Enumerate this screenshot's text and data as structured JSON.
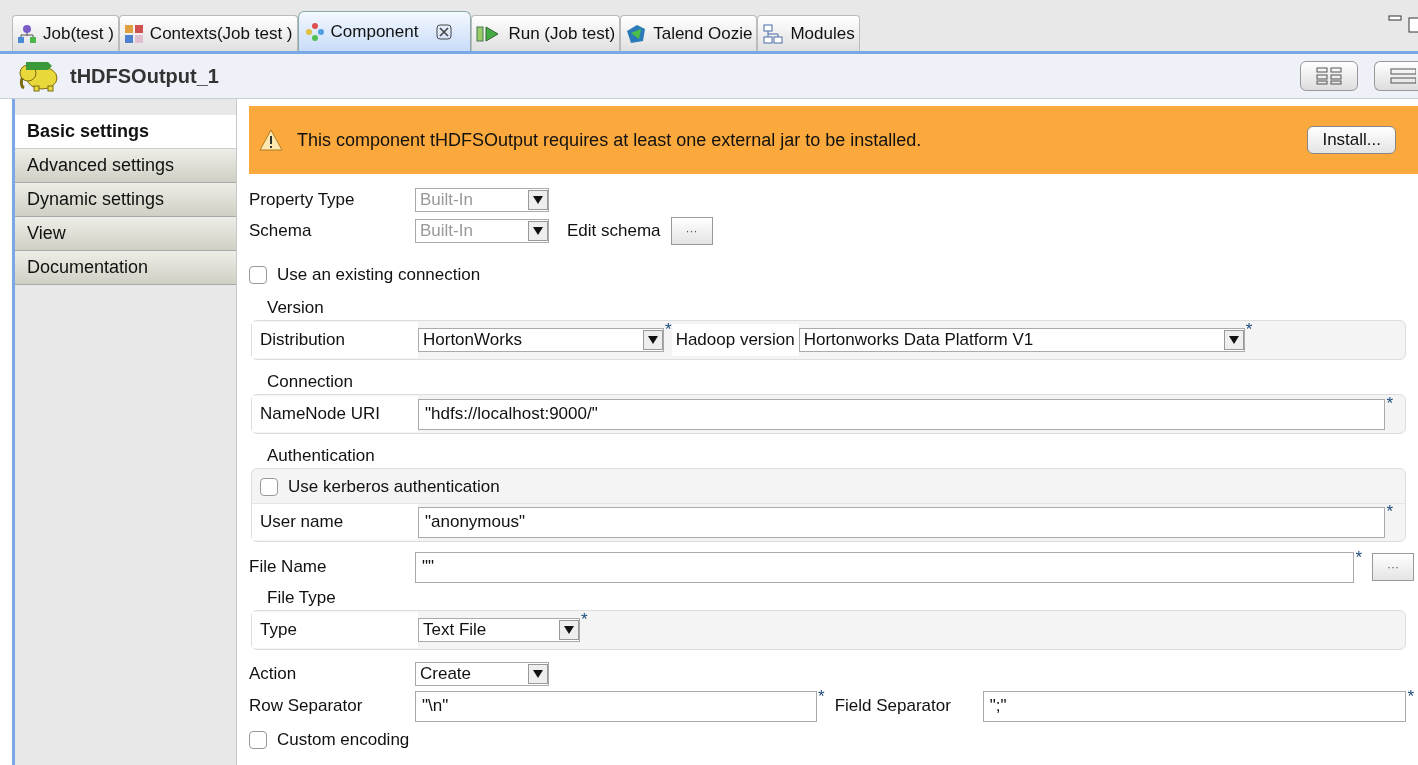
{
  "tabs": [
    {
      "label": "Job(test )",
      "selected": false,
      "kind": "job"
    },
    {
      "label": "Contexts(Job test )",
      "selected": false,
      "kind": "contexts"
    },
    {
      "label": "Component",
      "selected": true,
      "kind": "component",
      "closable": true
    },
    {
      "label": "Run (Job test)",
      "selected": false,
      "kind": "run"
    },
    {
      "label": "Talend Oozie",
      "selected": false,
      "kind": "oozie"
    },
    {
      "label": "Modules",
      "selected": false,
      "kind": "modules"
    }
  ],
  "component": {
    "title": "tHDFSOutput_1"
  },
  "nav": [
    {
      "label": "Basic settings",
      "selected": true
    },
    {
      "label": "Advanced settings",
      "selected": false
    },
    {
      "label": "Dynamic settings",
      "selected": false
    },
    {
      "label": "View",
      "selected": false
    },
    {
      "label": "Documentation",
      "selected": false
    }
  ],
  "warning": {
    "text": "This component tHDFSOutput requires at least one external jar to be installed.",
    "button": "Install..."
  },
  "form": [
    {
      "kind": "select",
      "label": "Property Type",
      "value": "Built-In",
      "disabled": true
    },
    {
      "kind": "select",
      "label": "Schema",
      "value": "Built-In",
      "disabled": true,
      "extra_label": "Edit schema",
      "button": "···"
    },
    {
      "kind": "checkbox",
      "label": "Use an existing connection",
      "checked": false
    },
    {
      "kind": "group",
      "title": "Version",
      "rows": [
        {
          "kind": "pair",
          "label": "Distribution",
          "value": "HortonWorks",
          "mark": "*",
          "label2": "Hadoop version",
          "value2": "Hortonworks Data Platform V1",
          "mark2": "*"
        }
      ]
    },
    {
      "kind": "group",
      "title": "Connection",
      "rows": [
        {
          "kind": "text",
          "label": "NameNode URI",
          "value": "\"hdfs://localhost:9000/\"",
          "mark": "*"
        }
      ]
    },
    {
      "kind": "group",
      "title": "Authentication",
      "rows": [
        {
          "kind": "checkbox",
          "label": "Use kerberos authentication",
          "checked": false
        },
        {
          "kind": "text",
          "label": "User name",
          "value": "\"anonymous\"",
          "mark": "*"
        }
      ]
    },
    {
      "kind": "text",
      "label": "File Name",
      "value": "\"\"",
      "mark": "*",
      "button": "···"
    },
    {
      "kind": "group",
      "title": "File Type",
      "rows": [
        {
          "kind": "select",
          "label": "Type",
          "value": "Text File",
          "disabled": false,
          "mark": "*"
        }
      ]
    },
    {
      "kind": "select",
      "label": "Action",
      "value": "Create",
      "disabled": false
    },
    {
      "kind": "separators",
      "label": "Row Separator",
      "value": "\"\\n\"",
      "mark": "*",
      "label2": "Field Separator",
      "value2": "\";\"",
      "mark2": "*"
    },
    {
      "kind": "checkbox",
      "label": "Custom encoding",
      "checked": false
    }
  ]
}
